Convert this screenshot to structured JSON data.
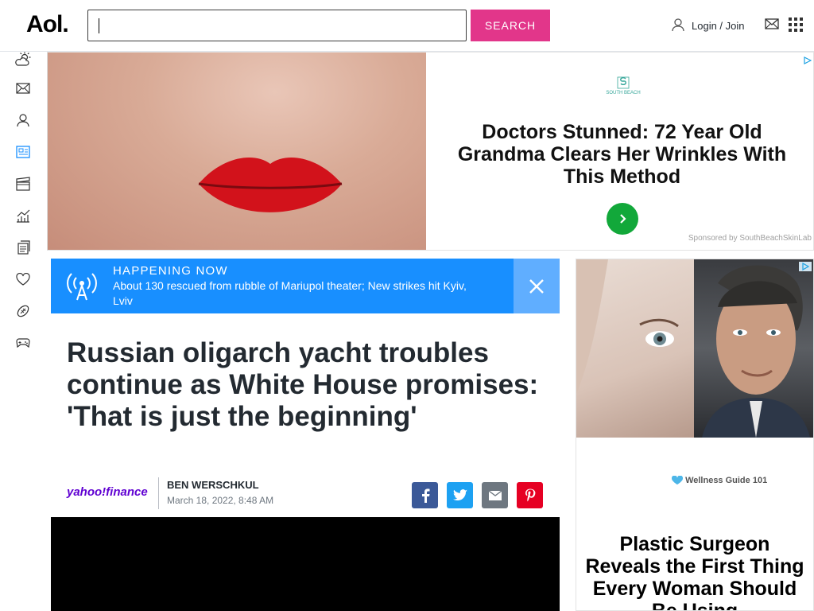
{
  "header": {
    "logo": "Aol.",
    "search": {
      "value": "",
      "button_label": "SEARCH"
    },
    "login_label": "Login / Join"
  },
  "rail": {
    "items": [
      "weather-icon",
      "mail-icon",
      "user-icon",
      "news-icon",
      "entertainment-icon",
      "finance-icon",
      "lifestyle-icon",
      "health-icon",
      "sports-icon",
      "games-icon"
    ]
  },
  "top_ad": {
    "brand": "SOUTH BEACH",
    "headline": "Doctors Stunned: 72 Year Old Grandma Clears Her Wrinkles With This Method",
    "sponsored": "Sponsored by SouthBeachSkinLab"
  },
  "happening": {
    "kicker": "HAPPENING NOW",
    "headline": "About 130 rescued from rubble of Mariupol theater; New strikes hit Kyiv, Lviv"
  },
  "article": {
    "title": "Russian oligarch yacht troubles continue as White House promises: 'That is just the beginning'",
    "source": "yahoo!finance",
    "author": "BEN WERSCHKUL",
    "date": "March 18, 2022, 8:48 AM"
  },
  "share": [
    "facebook-icon",
    "twitter-icon",
    "email-icon",
    "pinterest-icon"
  ],
  "colors": {
    "search_button": "#e2368a",
    "happening_bg": "#188fff",
    "facebook": "#3b5998",
    "twitter": "#1da1f2",
    "email": "#6e7780",
    "pinterest": "#e60023"
  },
  "right_ad": {
    "brand": "Wellness Guide 101",
    "headline": "Plastic Surgeon Reveals the First Thing Every Woman Should Be Using"
  }
}
